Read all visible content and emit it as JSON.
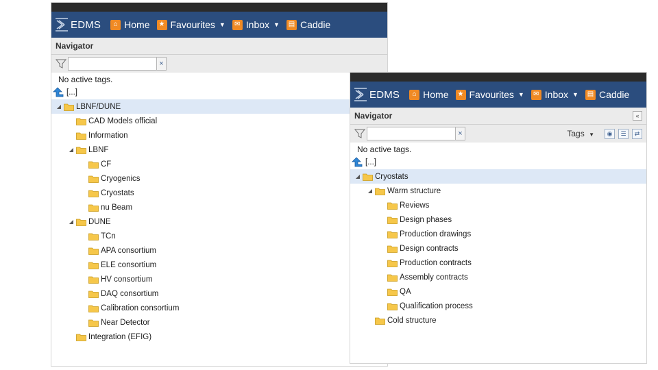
{
  "app": {
    "logo_text": "EDMS",
    "nav": [
      {
        "label": "Home",
        "icon": "home-icon",
        "caret": false
      },
      {
        "label": "Favourites",
        "icon": "star-icon",
        "caret": true
      },
      {
        "label": "Inbox",
        "icon": "envelope-icon",
        "caret": true
      },
      {
        "label": "Caddie",
        "icon": "cart-icon",
        "caret": false
      }
    ]
  },
  "navigator": {
    "title": "Navigator",
    "filter_value": "",
    "clear_label": "×",
    "status": "No active tags.",
    "tags_label": "Tags",
    "up_label": "[...]"
  },
  "trees": {
    "left": [
      {
        "label": "LBNF/DUNE",
        "depth": 0,
        "toggle": "expanded",
        "selected": true
      },
      {
        "label": "CAD Models official",
        "depth": 1,
        "toggle": "none"
      },
      {
        "label": "Information",
        "depth": 1,
        "toggle": "none"
      },
      {
        "label": "LBNF",
        "depth": 1,
        "toggle": "expanded"
      },
      {
        "label": "CF",
        "depth": 2,
        "toggle": "none"
      },
      {
        "label": "Cryogenics",
        "depth": 2,
        "toggle": "none"
      },
      {
        "label": "Cryostats",
        "depth": 2,
        "toggle": "none"
      },
      {
        "label": "nu Beam",
        "depth": 2,
        "toggle": "none"
      },
      {
        "label": "DUNE",
        "depth": 1,
        "toggle": "expanded"
      },
      {
        "label": "TCn",
        "depth": 2,
        "toggle": "none"
      },
      {
        "label": "APA consortium",
        "depth": 2,
        "toggle": "none"
      },
      {
        "label": "ELE consortium",
        "depth": 2,
        "toggle": "none"
      },
      {
        "label": "HV consortium",
        "depth": 2,
        "toggle": "none"
      },
      {
        "label": "DAQ consortium",
        "depth": 2,
        "toggle": "none"
      },
      {
        "label": "Calibration consortium",
        "depth": 2,
        "toggle": "none"
      },
      {
        "label": "Near Detector",
        "depth": 2,
        "toggle": "none"
      },
      {
        "label": "Integration (EFIG)",
        "depth": 1,
        "toggle": "none"
      }
    ],
    "right": [
      {
        "label": "Cryostats",
        "depth": 0,
        "toggle": "expanded",
        "selected": true
      },
      {
        "label": "Warm structure",
        "depth": 1,
        "toggle": "expanded"
      },
      {
        "label": "Reviews",
        "depth": 2,
        "toggle": "none"
      },
      {
        "label": "Design phases",
        "depth": 2,
        "toggle": "none"
      },
      {
        "label": "Production drawings",
        "depth": 2,
        "toggle": "none"
      },
      {
        "label": "Design contracts",
        "depth": 2,
        "toggle": "none"
      },
      {
        "label": "Production contracts",
        "depth": 2,
        "toggle": "none"
      },
      {
        "label": "Assembly contracts",
        "depth": 2,
        "toggle": "none"
      },
      {
        "label": "QA",
        "depth": 2,
        "toggle": "none"
      },
      {
        "label": "Qualification process",
        "depth": 2,
        "toggle": "none"
      },
      {
        "label": "Cold structure",
        "depth": 1,
        "toggle": "none"
      }
    ]
  },
  "colors": {
    "appbar": "#2b4d7e",
    "nav_icon": "#f08a24",
    "selected_row": "#dde8f6",
    "folder_fill": "#f6c74a",
    "folder_stroke": "#c99a1a"
  }
}
